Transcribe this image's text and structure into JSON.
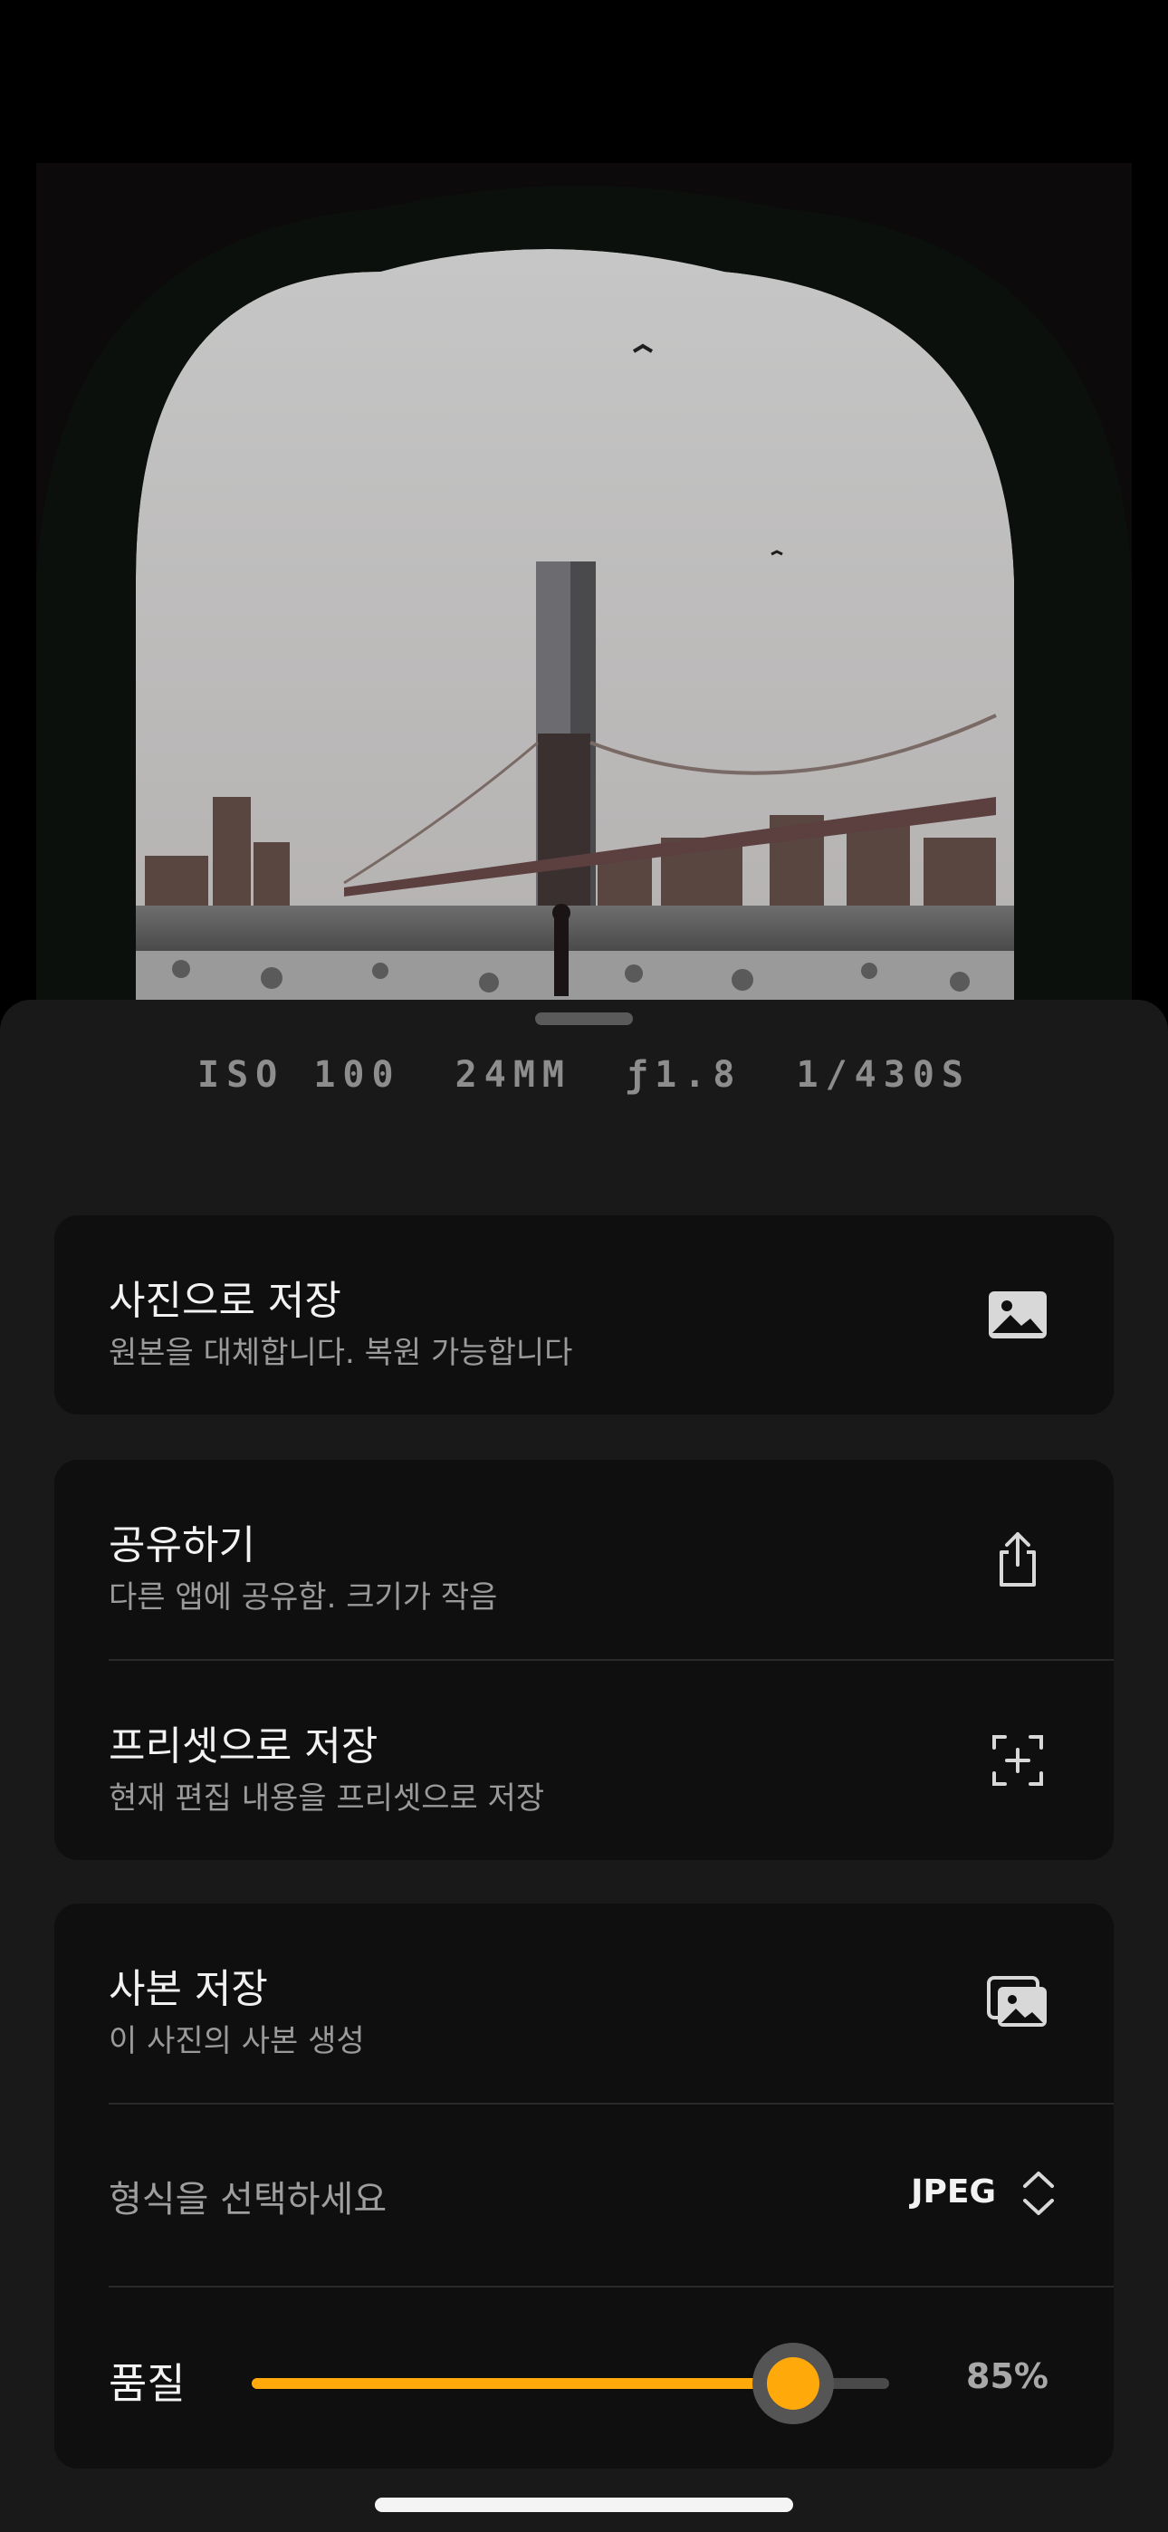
{
  "photo": {
    "description_icon": "photo-preview"
  },
  "exif": {
    "iso": "ISO 100",
    "focal": "24MM",
    "aperture": "ƒ1.8",
    "shutter": "1/430S"
  },
  "save_photo": {
    "title": "사진으로 저장",
    "subtitle": "원본을 대체합니다. 복원 가능합니다",
    "icon": "photo-icon"
  },
  "share": {
    "title": "공유하기",
    "subtitle": "다른 앱에 공유함. 크기가 작음",
    "icon": "share-icon"
  },
  "preset": {
    "title": "프리셋으로 저장",
    "subtitle": "현재 편집 내용을 프리셋으로 저장",
    "icon": "add-preset-icon"
  },
  "copy": {
    "title": "사본 저장",
    "subtitle": "이 사진의 사본 생성",
    "icon": "photo-stack-icon"
  },
  "format": {
    "label": "형식을 선택하세요",
    "value": "JPEG",
    "icon": "chevron-up-down-icon"
  },
  "quality": {
    "label": "품질",
    "value": 0.85,
    "display": "85%"
  },
  "colors": {
    "accent": "#ffa90a",
    "sheet": "#191919",
    "card": "#0f0f0f"
  }
}
